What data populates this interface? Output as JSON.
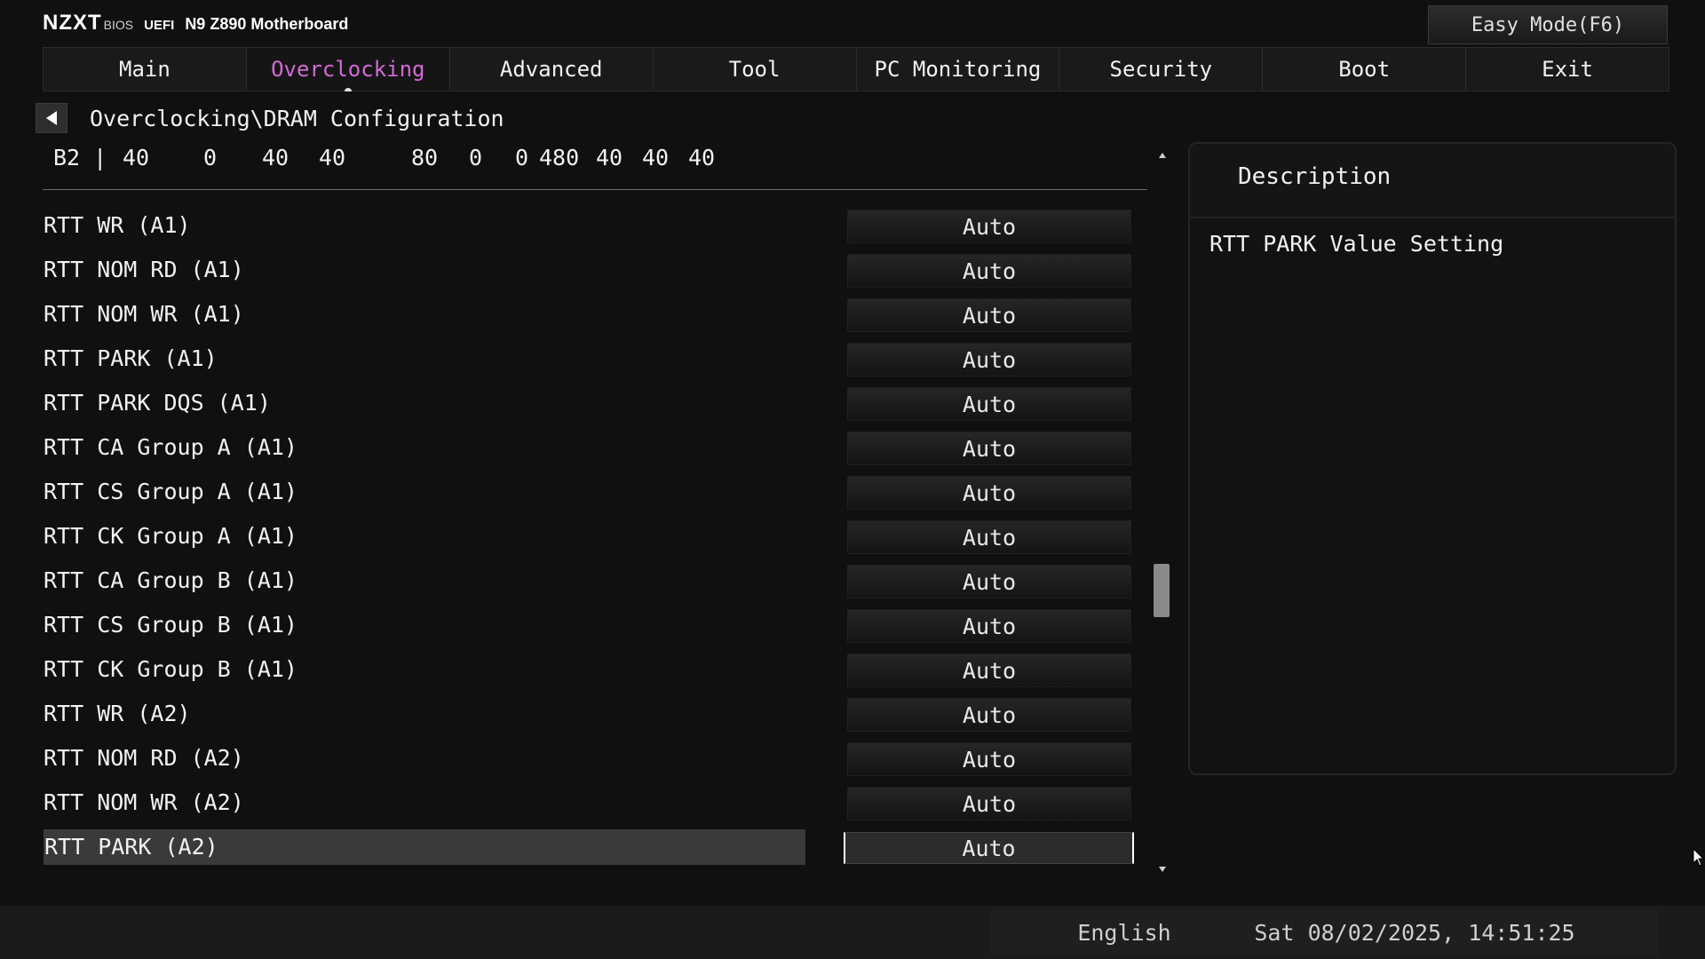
{
  "brand": {
    "logo": "NZXT",
    "bios": "BIOS",
    "uefi": "UEFI",
    "model": "N9 Z890 Motherboard"
  },
  "header": {
    "easy_mode": "Easy Mode(F6)"
  },
  "tabs": [
    {
      "label": "Main"
    },
    {
      "label": "Overclocking"
    },
    {
      "label": "Advanced"
    },
    {
      "label": "Tool"
    },
    {
      "label": "PC Monitoring"
    },
    {
      "label": "Security"
    },
    {
      "label": "Boot"
    },
    {
      "label": "Exit"
    }
  ],
  "active_tab": "Overclocking",
  "breadcrumb": "Overclocking\\DRAM Configuration",
  "timing_row": [
    "B2 |",
    "40",
    "0",
    "40",
    "40",
    "80",
    "0",
    "0",
    "480",
    "40",
    "40",
    "40"
  ],
  "settings": [
    {
      "label": "RTT WR (A1)",
      "value": "Auto"
    },
    {
      "label": "RTT NOM RD (A1)",
      "value": "Auto"
    },
    {
      "label": "RTT NOM WR (A1)",
      "value": "Auto"
    },
    {
      "label": "RTT PARK (A1)",
      "value": "Auto"
    },
    {
      "label": "RTT PARK DQS (A1)",
      "value": "Auto"
    },
    {
      "label": "RTT CA Group A (A1)",
      "value": "Auto"
    },
    {
      "label": "RTT CS Group A (A1)",
      "value": "Auto"
    },
    {
      "label": "RTT CK Group A (A1)",
      "value": "Auto"
    },
    {
      "label": "RTT CA Group B (A1)",
      "value": "Auto"
    },
    {
      "label": "RTT CS Group B (A1)",
      "value": "Auto"
    },
    {
      "label": "RTT CK Group B (A1)",
      "value": "Auto"
    },
    {
      "label": "RTT WR (A2)",
      "value": "Auto"
    },
    {
      "label": "RTT NOM RD (A2)",
      "value": "Auto"
    },
    {
      "label": "RTT NOM WR (A2)",
      "value": "Auto"
    },
    {
      "label": "RTT PARK (A2)",
      "value": "Auto",
      "selected": true
    }
  ],
  "scroll_position": 0.62,
  "description": {
    "title": "Description",
    "text": "RTT PARK Value Setting"
  },
  "footer": {
    "language": "English",
    "datetime": "Sat 08/02/2025, 14:51:25"
  },
  "colors": {
    "accent": "#d36ad6",
    "background": "#101010",
    "selected_row": "#3a3a3a"
  }
}
